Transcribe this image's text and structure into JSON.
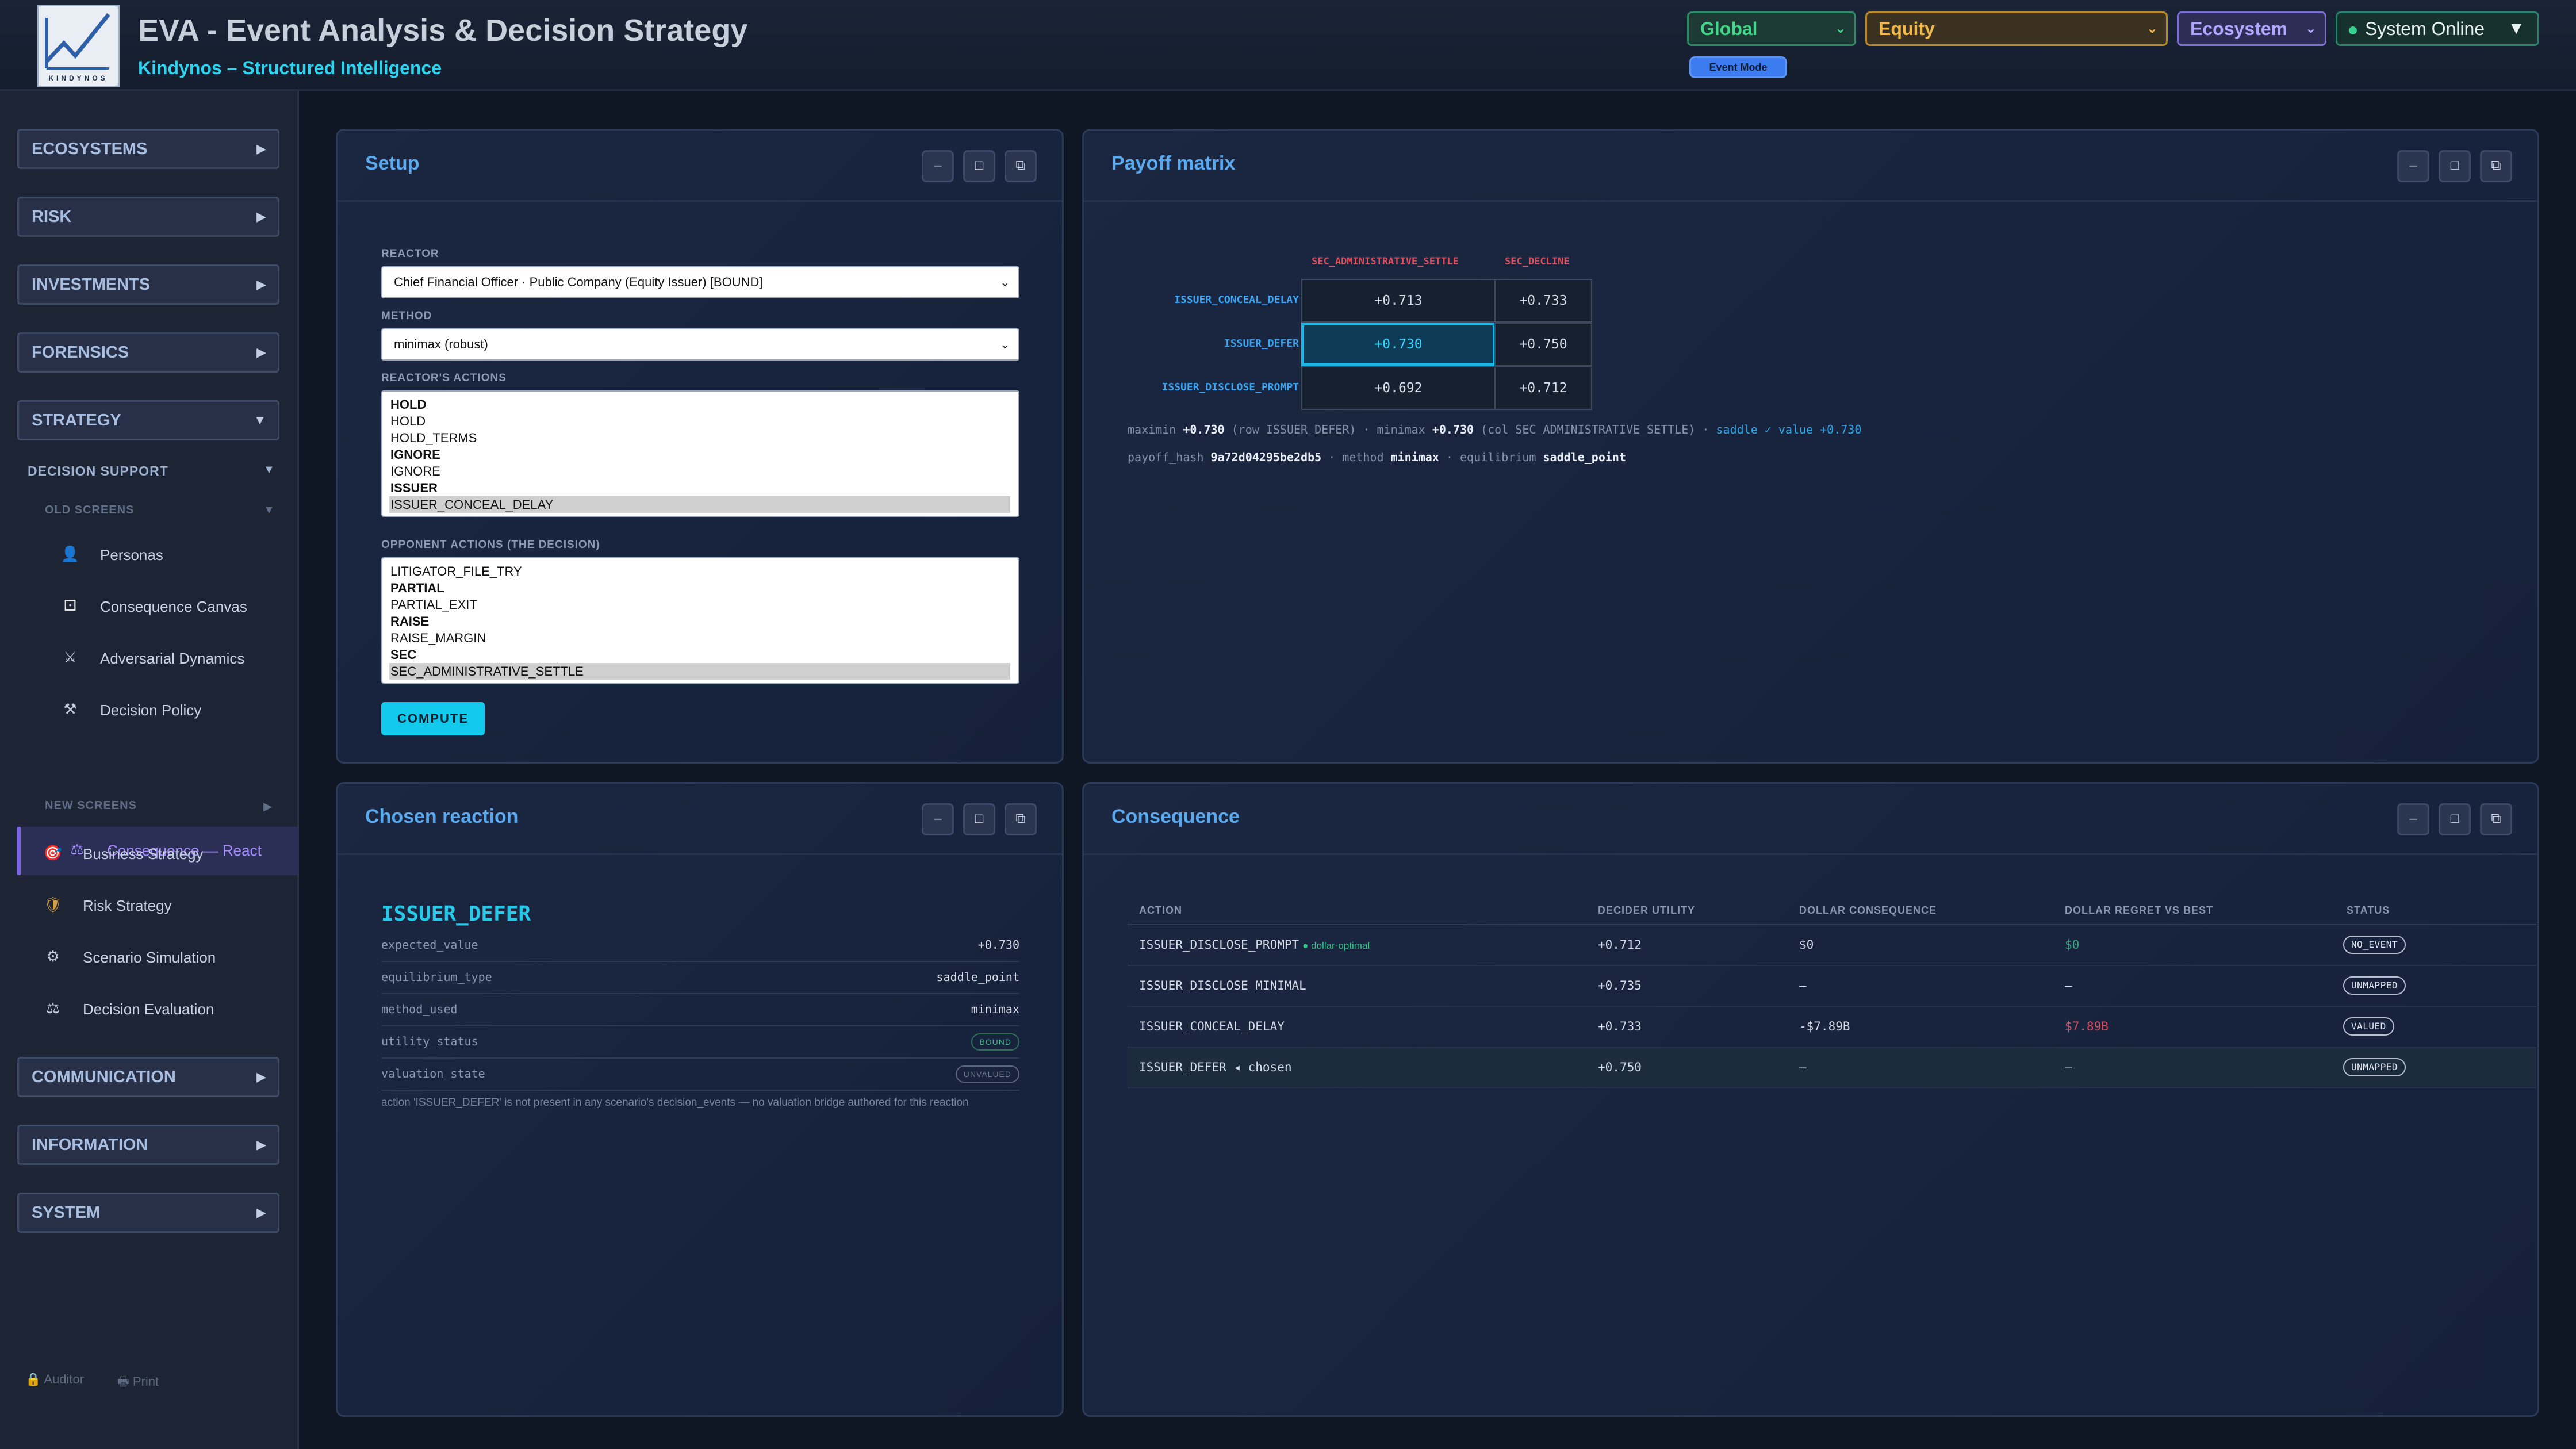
{
  "header": {
    "title": "EVA - Event Analysis & Decision Strategy",
    "subtitle": "Kindynos – Structured Intelligence",
    "logo_text": "KINDYNOS",
    "selects": {
      "scope": "Global",
      "asset": "Equity",
      "view": "Ecosystem"
    },
    "status": "System Online",
    "event_mode": "Event Mode"
  },
  "sidebar": {
    "sections": [
      "ECOSYSTEMS",
      "RISK",
      "INVESTMENTS",
      "FORENSICS",
      "STRATEGY"
    ],
    "decision_support": "DECISION SUPPORT",
    "old_screens": "OLD SCREENS",
    "old_items": [
      {
        "label": "Personas",
        "icon": "person-icon"
      },
      {
        "label": "Consequence Canvas",
        "icon": "dice-icon"
      },
      {
        "label": "Adversarial Dynamics",
        "icon": "crossed-swords-icon"
      },
      {
        "label": "Decision Policy",
        "icon": "hammer-pick-icon"
      },
      {
        "label": "Consequence — React",
        "icon": "scales-icon"
      }
    ],
    "new_screens": "NEW SCREENS",
    "new_items": [
      {
        "label": "Business Strategy",
        "icon": "target-icon"
      },
      {
        "label": "Risk Strategy",
        "icon": "shield-icon"
      },
      {
        "label": "Scenario Simulation",
        "icon": "gear-icon"
      },
      {
        "label": "Decision Evaluation",
        "icon": "scales-icon"
      }
    ],
    "lower_sections": [
      "COMMUNICATION",
      "INFORMATION",
      "SYSTEM"
    ],
    "footer": {
      "auditor": "Auditor",
      "print": "Print"
    }
  },
  "setup": {
    "title": "Setup",
    "reactor_label": "REACTOR",
    "reactor_value": "Chief Financial Officer · Public Company (Equity Issuer) [BOUND]",
    "method_label": "METHOD",
    "method_value": "minimax (robust)",
    "reactor_actions_label": "REACTOR'S ACTIONS",
    "reactor_actions": [
      {
        "text": "HOLD",
        "group": true
      },
      {
        "text": "HOLD",
        "group": false
      },
      {
        "text": "HOLD_TERMS",
        "group": false
      },
      {
        "text": "IGNORE",
        "group": true
      },
      {
        "text": "IGNORE",
        "group": false
      },
      {
        "text": "ISSUER",
        "group": true
      },
      {
        "text": "ISSUER_CONCEAL_DELAY",
        "group": false,
        "selected": true
      }
    ],
    "opponent_actions_label": "OPPONENT ACTIONS (THE DECISION)",
    "opponent_actions": [
      {
        "text": "LITIGATOR_FILE_TRY",
        "group": false
      },
      {
        "text": "PARTIAL",
        "group": true
      },
      {
        "text": "PARTIAL_EXIT",
        "group": false
      },
      {
        "text": "RAISE",
        "group": true
      },
      {
        "text": "RAISE_MARGIN",
        "group": false
      },
      {
        "text": "SEC",
        "group": true
      },
      {
        "text": "SEC_ADMINISTRATIVE_SETTLE",
        "group": false,
        "selected": true
      }
    ],
    "compute": "COMPUTE"
  },
  "payoff": {
    "title": "Payoff matrix",
    "columns": [
      "SEC_ADMINISTRATIVE_SETTLE",
      "SEC_DECLINE"
    ],
    "rows": [
      {
        "name": "ISSUER_CONCEAL_DELAY",
        "values": [
          "+0.713",
          "+0.733"
        ]
      },
      {
        "name": "ISSUER_DEFER",
        "values": [
          "+0.730",
          "+0.750"
        ]
      },
      {
        "name": "ISSUER_DISCLOSE_PROMPT",
        "values": [
          "+0.692",
          "+0.712"
        ]
      }
    ],
    "line1": {
      "maximin_lbl": "maximin ",
      "maximin_val": "+0.730",
      "maximin_ctx": " (row ISSUER_DEFER) · minimax ",
      "minimax_val": "+0.730",
      "minimax_ctx": " (col SEC_ADMINISTRATIVE_SETTLE) · ",
      "saddle": "saddle ✓ value +0.730"
    },
    "line2": {
      "hash_lbl": "payoff_hash ",
      "hash_val": "9a72d04295be2db5",
      "method_lbl": " · method ",
      "method_val": "minimax",
      "eq_lbl": " · equilibrium ",
      "eq_val": "saddle_point"
    }
  },
  "chosen": {
    "title": "Chosen reaction",
    "action": "ISSUER_DEFER",
    "fields": [
      {
        "key": "expected_value",
        "value": "+0.730"
      },
      {
        "key": "equilibrium_type",
        "value": "saddle_point"
      },
      {
        "key": "method_used",
        "value": "minimax"
      },
      {
        "key": "utility_status",
        "badge": "BOUND"
      },
      {
        "key": "valuation_state",
        "badge": "UNVALUED"
      }
    ],
    "note": "action 'ISSUER_DEFER' is not present in any scenario's decision_events — no valuation bridge authored for this reaction"
  },
  "consequence": {
    "title": "Consequence",
    "headers": [
      "ACTION",
      "DECIDER UTILITY",
      "DOLLAR CONSEQUENCE",
      "DOLLAR REGRET VS BEST",
      "STATUS"
    ],
    "rows": [
      {
        "action": "ISSUER_DISCLOSE_PROMPT",
        "tag": "● dollar-optimal",
        "utility": "+0.712",
        "dollar": "$0",
        "regret": "$0",
        "status": "NO_EVENT"
      },
      {
        "action": "ISSUER_DISCLOSE_MINIMAL",
        "tag": "",
        "utility": "+0.735",
        "dollar": "—",
        "regret": "—",
        "status": "UNMAPPED"
      },
      {
        "action": "ISSUER_CONCEAL_DELAY",
        "tag": "",
        "utility": "+0.733",
        "dollar": "-$7.89B",
        "regret": "$7.89B",
        "status": "VALUED"
      },
      {
        "action": "ISSUER_DEFER ◂ chosen",
        "tag": "",
        "utility": "+0.750",
        "dollar": "—",
        "regret": "—",
        "status": "UNMAPPED"
      }
    ]
  },
  "panel_buttons": {
    "minimize": "–",
    "maximize": "□",
    "popout": "⧉"
  },
  "colors": {
    "accent_cyan": "#13c9ec",
    "title_blue": "#5aa8ee",
    "column_red": "#e24d5c",
    "row_blue": "#3da4ef",
    "active_purple": "#a58bff"
  }
}
